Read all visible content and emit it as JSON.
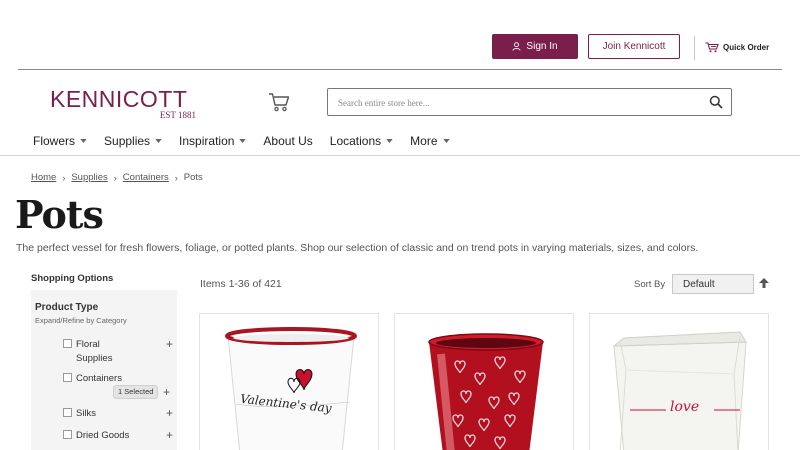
{
  "header": {
    "sign_in_label": "Sign In",
    "join_label": "Join Kennicott",
    "quick_order_label": "Quick Order",
    "logo_text": "KENNICOTT",
    "logo_sub": "EST 1881",
    "search": {
      "placeholder": "Search entire store here..."
    }
  },
  "nav": {
    "items": [
      {
        "label": "Flowers",
        "dropdown": true
      },
      {
        "label": "Supplies",
        "dropdown": true
      },
      {
        "label": "Inspiration",
        "dropdown": true
      },
      {
        "label": "About Us",
        "dropdown": false
      },
      {
        "label": "Locations",
        "dropdown": true
      },
      {
        "label": "More",
        "dropdown": true
      }
    ]
  },
  "breadcrumb": {
    "items": [
      {
        "label": "Home",
        "link": true
      },
      {
        "label": "Supplies",
        "link": true
      },
      {
        "label": "Containers",
        "link": true
      },
      {
        "label": "Pots",
        "link": false
      }
    ],
    "separator": "›"
  },
  "page": {
    "title": "Pots",
    "description": "The perfect vessel for fresh flowers, foliage, or potted plants. Shop our selection of classic and on trend pots in varying materials, sizes, and colors."
  },
  "sidebar": {
    "heading": "Shopping Options",
    "filter": {
      "title": "Product Type",
      "subtitle": "Expand/Refine by Category",
      "items": [
        {
          "label_line1": "Floral",
          "label_line2": "Supplies"
        },
        {
          "label_line1": "Containers",
          "label_line2": "",
          "selected_badge": "1 Selected"
        },
        {
          "label_line1": "Silks",
          "label_line2": ""
        },
        {
          "label_line1": "Dried Goods",
          "label_line2": ""
        }
      ],
      "expand_symbol": "+"
    }
  },
  "toolbar": {
    "items_count": "Items 1-36 of 421",
    "sort_label": "Sort By",
    "sort_value": "Default"
  },
  "products": [
    {
      "image": "white-pot-valentines-day",
      "pot_text": "Valentine's day"
    },
    {
      "image": "red-metallic-heart-pot"
    },
    {
      "image": "white-paper-bag-pot",
      "pot_text": "love"
    }
  ],
  "colors": {
    "brand": "#7a1f4b",
    "text": "#333333",
    "red": "#c8102e"
  }
}
